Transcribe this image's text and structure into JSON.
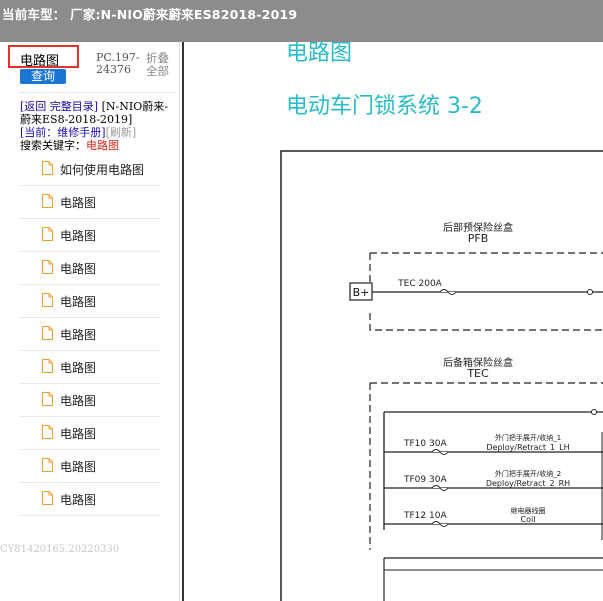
{
  "topbar": {
    "label": "当前车型：",
    "value": " 厂家:N-NIO蔚来蔚来ES82018-2019"
  },
  "sidebar": {
    "search": {
      "value": "电路图",
      "placeholder": ""
    },
    "query_button": "查询",
    "pc_code": "PC.197-24376",
    "fold_all": "折叠全部",
    "nav": {
      "back": "[返回",
      "full_catalog": "完整目录]",
      "model": "[N-NIO蔚来-蔚来ES8-2018-2019]",
      "current_prefix": "[当前：",
      "current_page": "维修手册]",
      "refresh": "[刷新]",
      "keyword_label": "搜索关键字：",
      "keyword": "电路图"
    },
    "items": [
      {
        "label": "如何使用电路图"
      },
      {
        "label": "电路图"
      },
      {
        "label": "电路图"
      },
      {
        "label": "电路图"
      },
      {
        "label": "电路图"
      },
      {
        "label": "电路图"
      },
      {
        "label": "电路图"
      },
      {
        "label": "电路图"
      },
      {
        "label": "电路图"
      },
      {
        "label": "电路图"
      },
      {
        "label": "电路图"
      }
    ],
    "footer_code": "CY81420165.20220330"
  },
  "main": {
    "heading": "电路图",
    "subheading": "电动车门锁系统 3-2",
    "diagram": {
      "pfb_cn": "后部预保险丝盒",
      "pfb": "PFB",
      "battery": "B+",
      "fuse_pfb": "TEC 200A",
      "tec_cn": "后备箱保险丝盒",
      "tec": "TEC",
      "fuses": [
        {
          "name": "TF10 30A",
          "desc_cn": "外门把手展开/收纳_1",
          "desc_en": "Deploy/Retract_1_LH"
        },
        {
          "name": "TF09 30A",
          "desc_cn": "外门把手展开/收纳_2",
          "desc_en": "Deploy/Retract_2_RH"
        },
        {
          "name": "TF12 10A",
          "desc_cn": "继电器线圈",
          "desc_en": "Coil"
        }
      ]
    }
  }
}
